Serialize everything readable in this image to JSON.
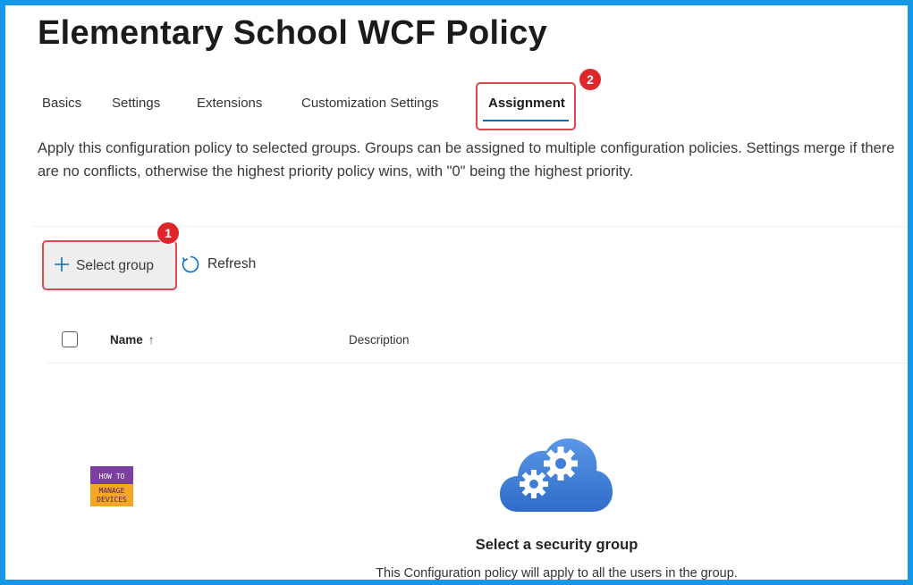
{
  "page": {
    "title": "Elementary School WCF Policy"
  },
  "tabs": [
    {
      "label": "Basics",
      "active": false
    },
    {
      "label": "Settings",
      "active": false
    },
    {
      "label": "Extensions",
      "active": false
    },
    {
      "label": "Customization Settings",
      "active": false
    },
    {
      "label": "Assignment",
      "active": true
    }
  ],
  "description": "Apply this configuration policy to selected groups. Groups can be assigned to multiple configuration policies. Settings merge if there are no conflicts, otherwise the highest priority policy wins, with \"0\" being the highest priority.",
  "toolbar": {
    "select_group_label": "Select group",
    "select_group_icon": "plus-icon",
    "refresh_label": "Refresh",
    "refresh_icon": "refresh-icon"
  },
  "table": {
    "columns": [
      "Name",
      "Description"
    ],
    "sort_indicator": "↑",
    "rows": []
  },
  "empty_state": {
    "icon": "cloud-gears-icon",
    "title": "Select a security group",
    "subtitle": "This Configuration policy will apply to all the users in the group."
  },
  "annotations": {
    "step1": "1",
    "step2": "2",
    "highlight_color": "#e0484f",
    "badge_color": "#e0262d"
  },
  "watermark": {
    "line1": "HOW TO",
    "line2": "MANAGE",
    "line3": "DEVICES"
  },
  "colors": {
    "frame_border": "#1597e8",
    "tab_underline": "#0f6cbd",
    "cloud_fill": "#4f8be0"
  }
}
